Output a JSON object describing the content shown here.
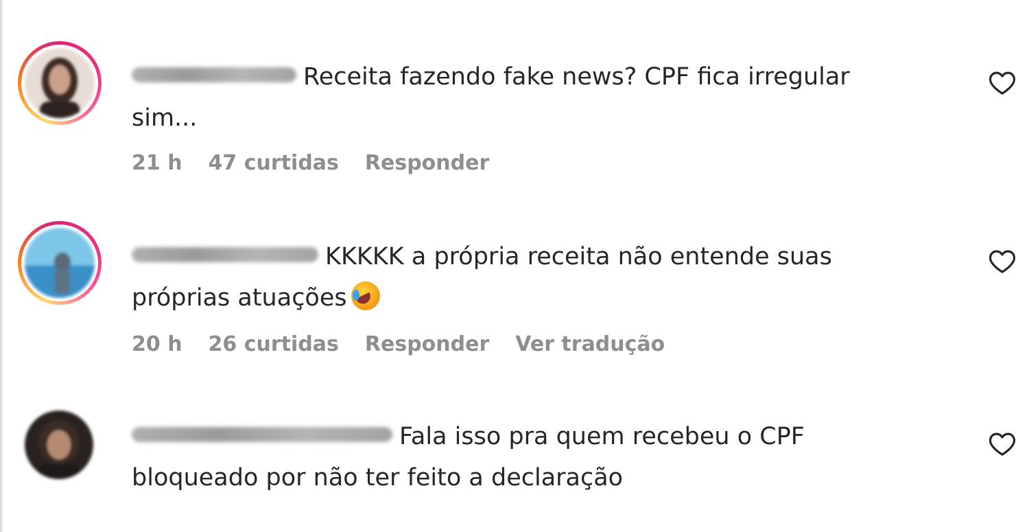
{
  "comments": [
    {
      "text_line1": "Receita fazendo fake news? CPF fica irregular",
      "text_line2": "sim...",
      "time": "21 h",
      "likes": "47 curtidas",
      "reply": "Responder",
      "avatar_ring": true,
      "like_icon": "heart-outline-icon"
    },
    {
      "text_line1": "KKKKK a própria receita não entende suas",
      "text_line2": "próprias atuações",
      "emoji": "rolling-on-floor-laughing-emoji",
      "time": "20 h",
      "likes": "26 curtidas",
      "reply": "Responder",
      "translate": "Ver tradução",
      "avatar_ring": true,
      "like_icon": "heart-outline-icon"
    },
    {
      "text_line1": "Fala isso pra quem recebeu o CPF",
      "text_line2": "bloqueado por não ter feito a declaração",
      "avatar_ring": false,
      "like_icon": "heart-outline-icon"
    }
  ],
  "colors": {
    "text": "#262626",
    "meta": "#8e8e8e",
    "story_ring": [
      "#feda75",
      "#fa7e1e",
      "#d62976"
    ]
  }
}
